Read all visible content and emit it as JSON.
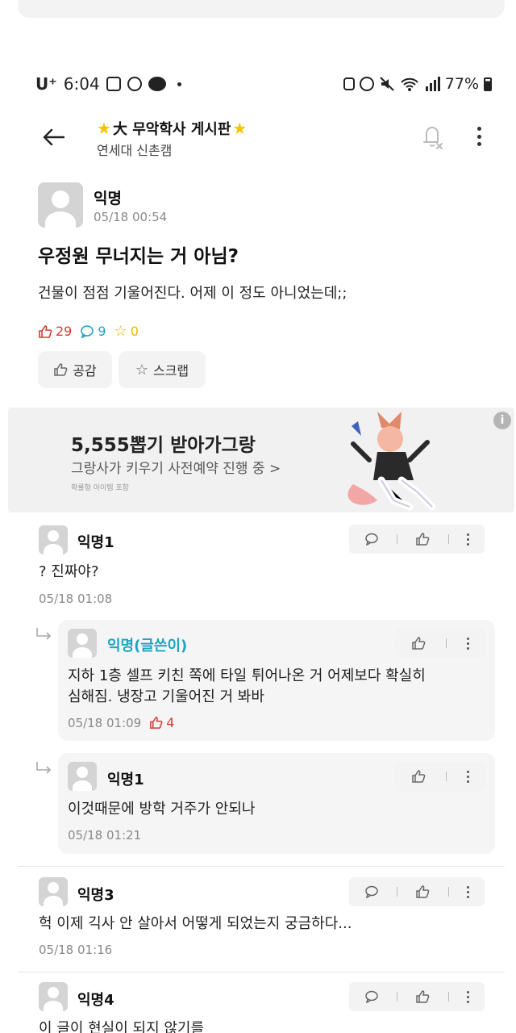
{
  "status_bar": {
    "carrier": "U⁺",
    "time": "6:04",
    "battery": "77%"
  },
  "header": {
    "board_title": "大 무악학사 게시판",
    "board_subtitle": "연세대 신촌캠"
  },
  "post": {
    "author": "익명",
    "date": "05/18 00:54",
    "title": "우정원 무너지는 거 아님?",
    "body": "건물이 점점 기울어진다. 어제 이 정도 아니었는데;;",
    "likes": "29",
    "comments": "9",
    "scraps": "0",
    "like_button": "공감",
    "scrap_button": "스크랩"
  },
  "ad": {
    "title": "5,555뽑기 받아가그랑",
    "subtitle": "그랑사가 키우기 사전예약 진행 중 >",
    "fine_print": "확률형 아이템 포함",
    "info": "i"
  },
  "comments": [
    {
      "author": "익명1",
      "text": "? 진짜야?",
      "date": "05/18 01:08",
      "replies": [
        {
          "author": "익명(글쓴이)",
          "text_line1": "지하 1층 셀프 키친 쪽에 타일 튀어나온 거 어제보다 확실히",
          "text_line2": "심해짐. 냉장고 기울어진 거 봐바",
          "date": "05/18 01:09",
          "likes": "4"
        },
        {
          "author": "익명1",
          "text": "이것때문에 방학 거주가 안되나",
          "date": "05/18 01:21"
        }
      ]
    },
    {
      "author": "익명3",
      "text": "헉 이제 긱사 안 살아서 어떻게 되었는지 궁금하다...",
      "date": "05/18 01:16"
    },
    {
      "author": "익명4",
      "text": "이 글이 현실이 되지 않기를"
    }
  ]
}
